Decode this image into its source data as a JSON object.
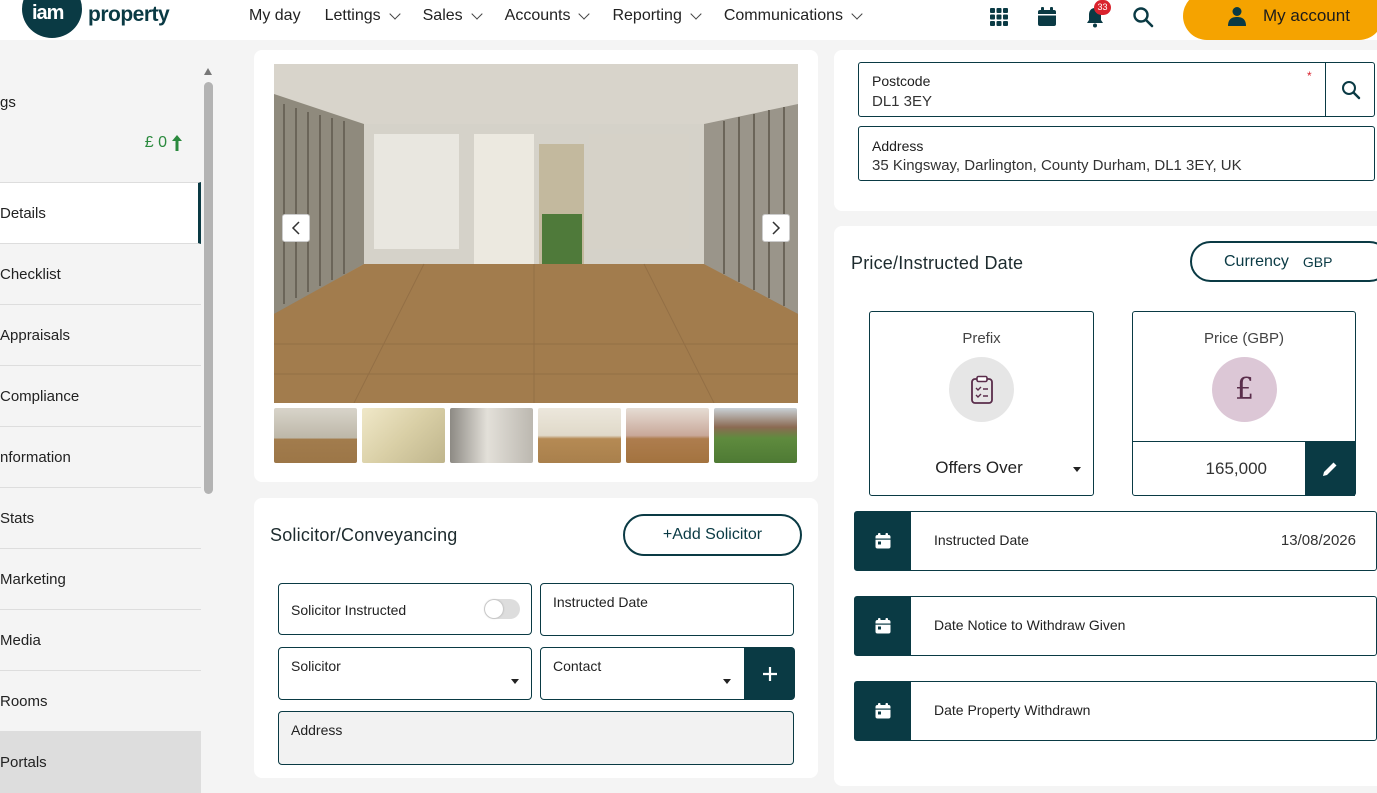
{
  "brand": {
    "logo_mark": "iam",
    "logo_word": "property"
  },
  "nav": {
    "items": [
      {
        "label": "My day",
        "has_dropdown": false
      },
      {
        "label": "Lettings",
        "has_dropdown": true
      },
      {
        "label": "Sales",
        "has_dropdown": true
      },
      {
        "label": "Accounts",
        "has_dropdown": true
      },
      {
        "label": "Reporting",
        "has_dropdown": true
      },
      {
        "label": "Communications",
        "has_dropdown": true
      }
    ],
    "notification_count": "33",
    "account_label": "My account"
  },
  "sidebar": {
    "top_label": "gs",
    "balance": "£ 0",
    "items": [
      {
        "label": "Details",
        "active": true
      },
      {
        "label": "Checklist"
      },
      {
        "label": "Appraisals"
      },
      {
        "label": "Compliance"
      },
      {
        "label": "nformation"
      },
      {
        "label": "Stats"
      },
      {
        "label": "Marketing"
      },
      {
        "label": "Media"
      },
      {
        "label": "Rooms"
      },
      {
        "label": "Portals",
        "dim": true
      }
    ]
  },
  "solicitor": {
    "title": "Solicitor/Conveyancing",
    "add_button": "+Add Solicitor",
    "instructed_toggle_label": "Solicitor Instructed",
    "instructed_date_label": "Instructed Date",
    "solicitor_label": "Solicitor",
    "contact_label": "Contact",
    "address_label": "Address"
  },
  "address": {
    "postcode_label": "Postcode",
    "postcode_required": "*",
    "postcode_value": "DL1 3EY",
    "address_label": "Address",
    "address_value": "35 Kingsway, Darlington, County Durham, DL1 3EY, UK"
  },
  "price": {
    "title": "Price/Instructed Date",
    "currency_label": "Currency",
    "currency_value": "GBP",
    "prefix_label": "Prefix",
    "prefix_value": "Offers Over",
    "price_label": "Price (GBP)",
    "price_value": "165,000",
    "dates": [
      {
        "label": "Instructed Date",
        "value": "13/08/2026"
      },
      {
        "label": "Date Notice to Withdraw Given",
        "value": ""
      },
      {
        "label": "Date Property Withdrawn",
        "value": ""
      }
    ]
  },
  "colors": {
    "brand_dark": "#0a3a44",
    "accent": "#f5a300",
    "positive": "#2b8a3e",
    "badge": "#d9232e"
  }
}
